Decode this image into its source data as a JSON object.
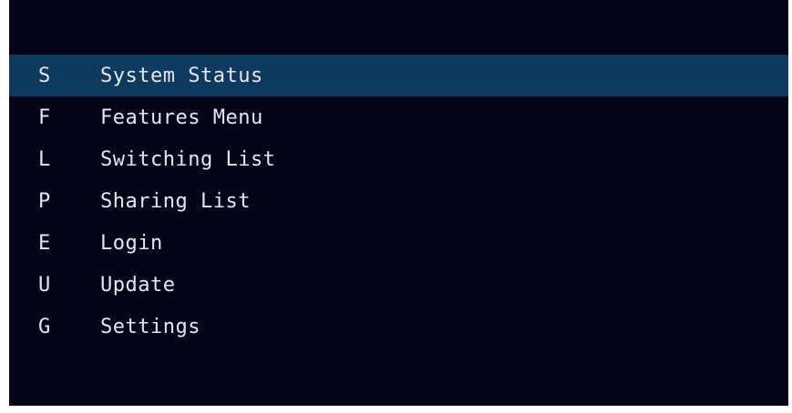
{
  "menu": {
    "selected_index": 0,
    "items": [
      {
        "key": "S",
        "label": "System Status"
      },
      {
        "key": "F",
        "label": "Features Menu"
      },
      {
        "key": "L",
        "label": "Switching List"
      },
      {
        "key": "P",
        "label": "Sharing List"
      },
      {
        "key": "E",
        "label": "Login"
      },
      {
        "key": "U",
        "label": "Update"
      },
      {
        "key": "G",
        "label": "Settings"
      }
    ]
  },
  "colors": {
    "background": "#050518",
    "selected_row": "#0f3a5f",
    "text": "#e6e6ee"
  }
}
